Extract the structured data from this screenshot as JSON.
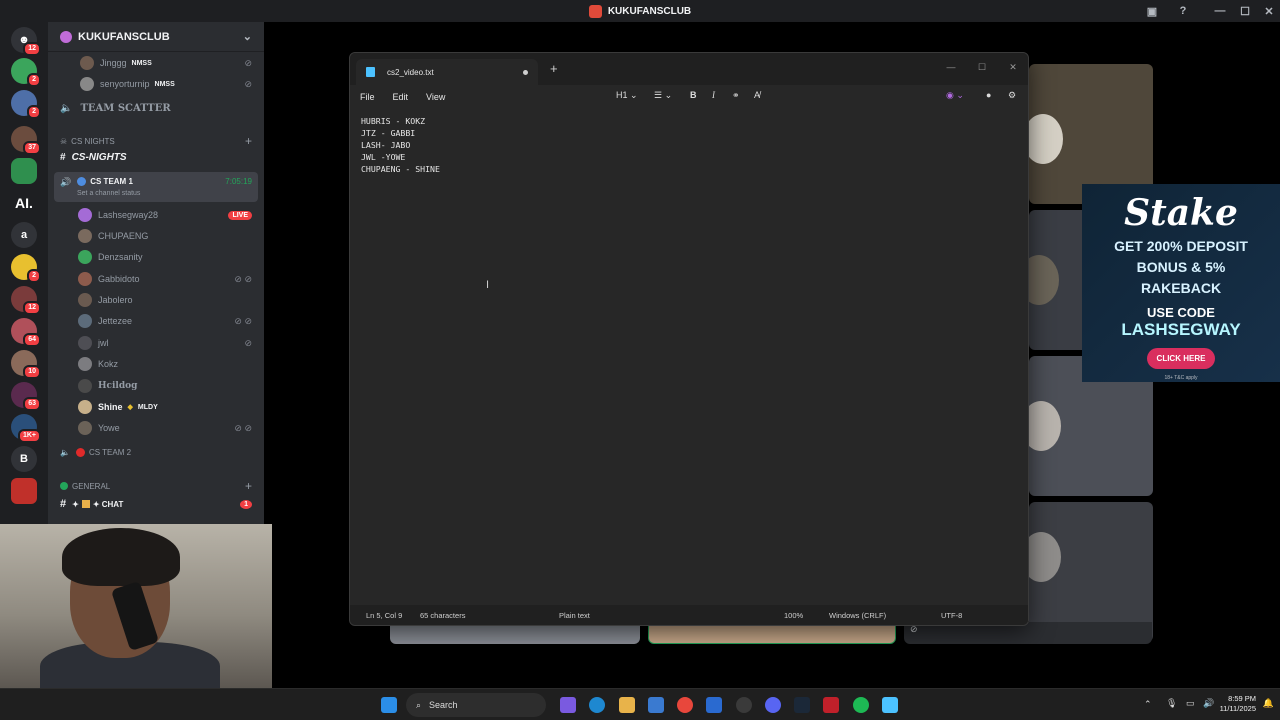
{
  "window_title": "KUKUFANSCLUB",
  "server": {
    "name": "KUKUFANSCLUB",
    "rail_badges": [
      "12",
      "2",
      "2",
      "37",
      "2",
      "2",
      "12",
      "64",
      "10",
      "63",
      "1K+"
    ],
    "rail_letters": [
      "AI.",
      "a",
      "B"
    ]
  },
  "sidebar": {
    "top_users": [
      {
        "name": "Jinggg",
        "tag": "NMSS"
      },
      {
        "name": "senyorturnip",
        "tag": "NMSS"
      }
    ],
    "team_scatter": "TEAM SCATTER",
    "category_cs_nights": "CS NIGHTS",
    "channel_cs_nights": "CS-NIGHTS",
    "voice_cs_team1": {
      "name": "CS TEAM 1",
      "timer": "7:05:19",
      "status": "Set a channel status"
    },
    "members": [
      {
        "name": "Lashsegway28",
        "live": "LIVE",
        "color": "#a46bd6"
      },
      {
        "name": "CHUPAENG",
        "color": "#7a6a5e"
      },
      {
        "name": "Denzsanity",
        "color": "#3ba55c"
      },
      {
        "name": "Gabbidoto",
        "color": "#8d5b4c"
      },
      {
        "name": "Jabolero",
        "color": "#6a5a50"
      },
      {
        "name": "Jettezee",
        "color": "#5c6b7a"
      },
      {
        "name": "jwl",
        "color": "#4e4e54"
      },
      {
        "name": "Kokz",
        "color": "#7c7c80"
      },
      {
        "name": "Hcildog",
        "color": "#4a4a4a"
      },
      {
        "name": "Shine",
        "tag": "MLDY",
        "color": "#c7b08a"
      },
      {
        "name": "Yowe",
        "color": "#6b6258"
      }
    ],
    "voice_cs_team2": "CS TEAM 2",
    "category_general": "GENERAL",
    "channel_chat": "✦ CHAT",
    "chat_badge": "1"
  },
  "ad": {
    "logo": "Stake",
    "line1": "GET 200% DEPOSIT",
    "line2": "BONUS & 5%",
    "line3": "RAKEBACK",
    "line4": "USE CODE",
    "code": "LASHSEGWAY",
    "cta": "CLICK HERE",
    "fine": "18+ T&C apply"
  },
  "notepad": {
    "tab_title": "cs2_video.txt",
    "menu": [
      "File",
      "Edit",
      "View"
    ],
    "heading_label": "H1",
    "lines": [
      "HUBRIS - KOKZ",
      "JTZ - GABBI",
      "LASH- JABO",
      "JWL -YOWE",
      "CHUPAENG - SHINE"
    ],
    "status": {
      "position": "Ln 5, Col 9",
      "chars": "65 characters",
      "format": "Plain text",
      "zoom": "100%",
      "eol": "Windows (CRLF)",
      "encoding": "UTF-8"
    }
  },
  "taskbar": {
    "search_placeholder": "Search",
    "time": "8:59 PM",
    "date": "11/11/2025"
  }
}
